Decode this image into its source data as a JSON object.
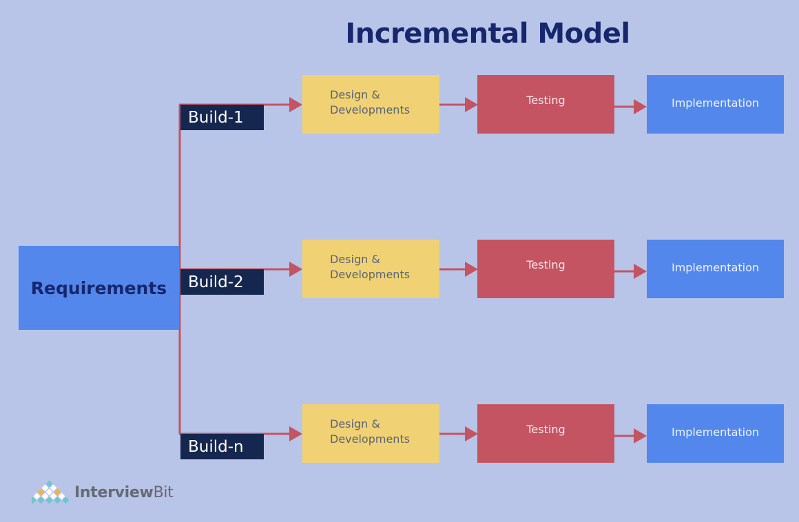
{
  "title": "Incremental Model",
  "requirements": {
    "label": "Requirements"
  },
  "builds": [
    {
      "label": "Build-1",
      "design": [
        "Design &",
        "Developments"
      ],
      "testing": "Testing",
      "implementation": "Implementation"
    },
    {
      "label": "Build-2",
      "design": [
        "Design &",
        "Developments"
      ],
      "testing": "Testing",
      "implementation": "Implementation"
    },
    {
      "label": "Build-n",
      "design": [
        "Design &",
        "Developments"
      ],
      "testing": "Testing",
      "implementation": "Implementation"
    }
  ],
  "logo": {
    "name_bold": "Interview",
    "name_regular": "Bit"
  },
  "colors": {
    "background": "#b8c4e8",
    "title": "#16276e",
    "requirements": "#5387ec",
    "build_label": "#15274f",
    "design": "#f0d274",
    "testing": "#c55462",
    "implementation": "#5387ec",
    "connector": "#c55462"
  }
}
